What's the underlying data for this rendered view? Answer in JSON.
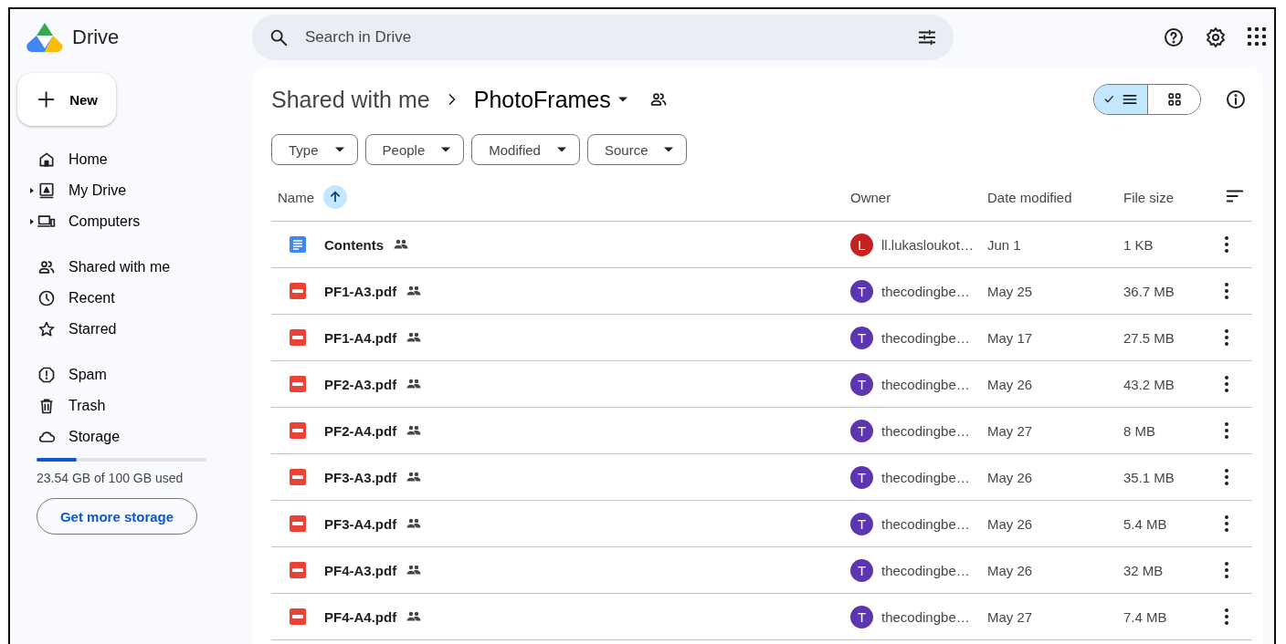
{
  "app": {
    "name": "Drive"
  },
  "search": {
    "placeholder": "Search in Drive"
  },
  "new_button": "New",
  "nav_groups": [
    [
      {
        "label": "Home",
        "has_children": false
      },
      {
        "label": "My Drive",
        "has_children": true
      },
      {
        "label": "Computers",
        "has_children": true
      }
    ],
    [
      {
        "label": "Shared with me",
        "has_children": false
      },
      {
        "label": "Recent",
        "has_children": false
      },
      {
        "label": "Starred",
        "has_children": false
      }
    ],
    [
      {
        "label": "Spam",
        "has_children": false
      },
      {
        "label": "Trash",
        "has_children": false
      },
      {
        "label": "Storage",
        "has_children": false
      }
    ]
  ],
  "storage": {
    "level": 0.2354,
    "text": "23.54 GB of 100 GB used",
    "button": "Get more storage"
  },
  "breadcrumb": [
    "Shared with me",
    "PhotoFrames"
  ],
  "view_toggle": [
    {
      "kind": "list",
      "selected": true
    },
    {
      "kind": "grid",
      "selected": false
    }
  ],
  "filters": [
    "Type",
    "People",
    "Modified",
    "Source"
  ],
  "table": {
    "columns": [
      "Name",
      "Owner",
      "Date modified",
      "File size"
    ],
    "rows": [
      {
        "kind": "doc",
        "name": "Contents",
        "owner": "ll.lukasloukot…",
        "owner_initial": "L",
        "color": "#c5221f",
        "date": "Jun 1",
        "size": "1 KB"
      },
      {
        "kind": "pdf",
        "name": "PF1-A3.pdf",
        "owner": "thecodingbe…",
        "owner_initial": "T",
        "color": "#5e35b1",
        "date": "May 25",
        "size": "36.7 MB"
      },
      {
        "kind": "pdf",
        "name": "PF1-A4.pdf",
        "owner": "thecodingbe…",
        "owner_initial": "T",
        "color": "#5e35b1",
        "date": "May 17",
        "size": "27.5 MB"
      },
      {
        "kind": "pdf",
        "name": "PF2-A3.pdf",
        "owner": "thecodingbe…",
        "owner_initial": "T",
        "color": "#5e35b1",
        "date": "May 26",
        "size": "43.2 MB"
      },
      {
        "kind": "pdf",
        "name": "PF2-A4.pdf",
        "owner": "thecodingbe…",
        "owner_initial": "T",
        "color": "#5e35b1",
        "date": "May 27",
        "size": "8 MB"
      },
      {
        "kind": "pdf",
        "name": "PF3-A3.pdf",
        "owner": "thecodingbe…",
        "owner_initial": "T",
        "color": "#5e35b1",
        "date": "May 26",
        "size": "35.1 MB"
      },
      {
        "kind": "pdf",
        "name": "PF3-A4.pdf",
        "owner": "thecodingbe…",
        "owner_initial": "T",
        "color": "#5e35b1",
        "date": "May 26",
        "size": "5.4 MB"
      },
      {
        "kind": "pdf",
        "name": "PF4-A3.pdf",
        "owner": "thecodingbe…",
        "owner_initial": "T",
        "color": "#5e35b1",
        "date": "May 26",
        "size": "32 MB"
      },
      {
        "kind": "pdf",
        "name": "PF4-A4.pdf",
        "owner": "thecodingbe…",
        "owner_initial": "T",
        "color": "#5e35b1",
        "date": "May 27",
        "size": "7.4 MB"
      }
    ]
  }
}
